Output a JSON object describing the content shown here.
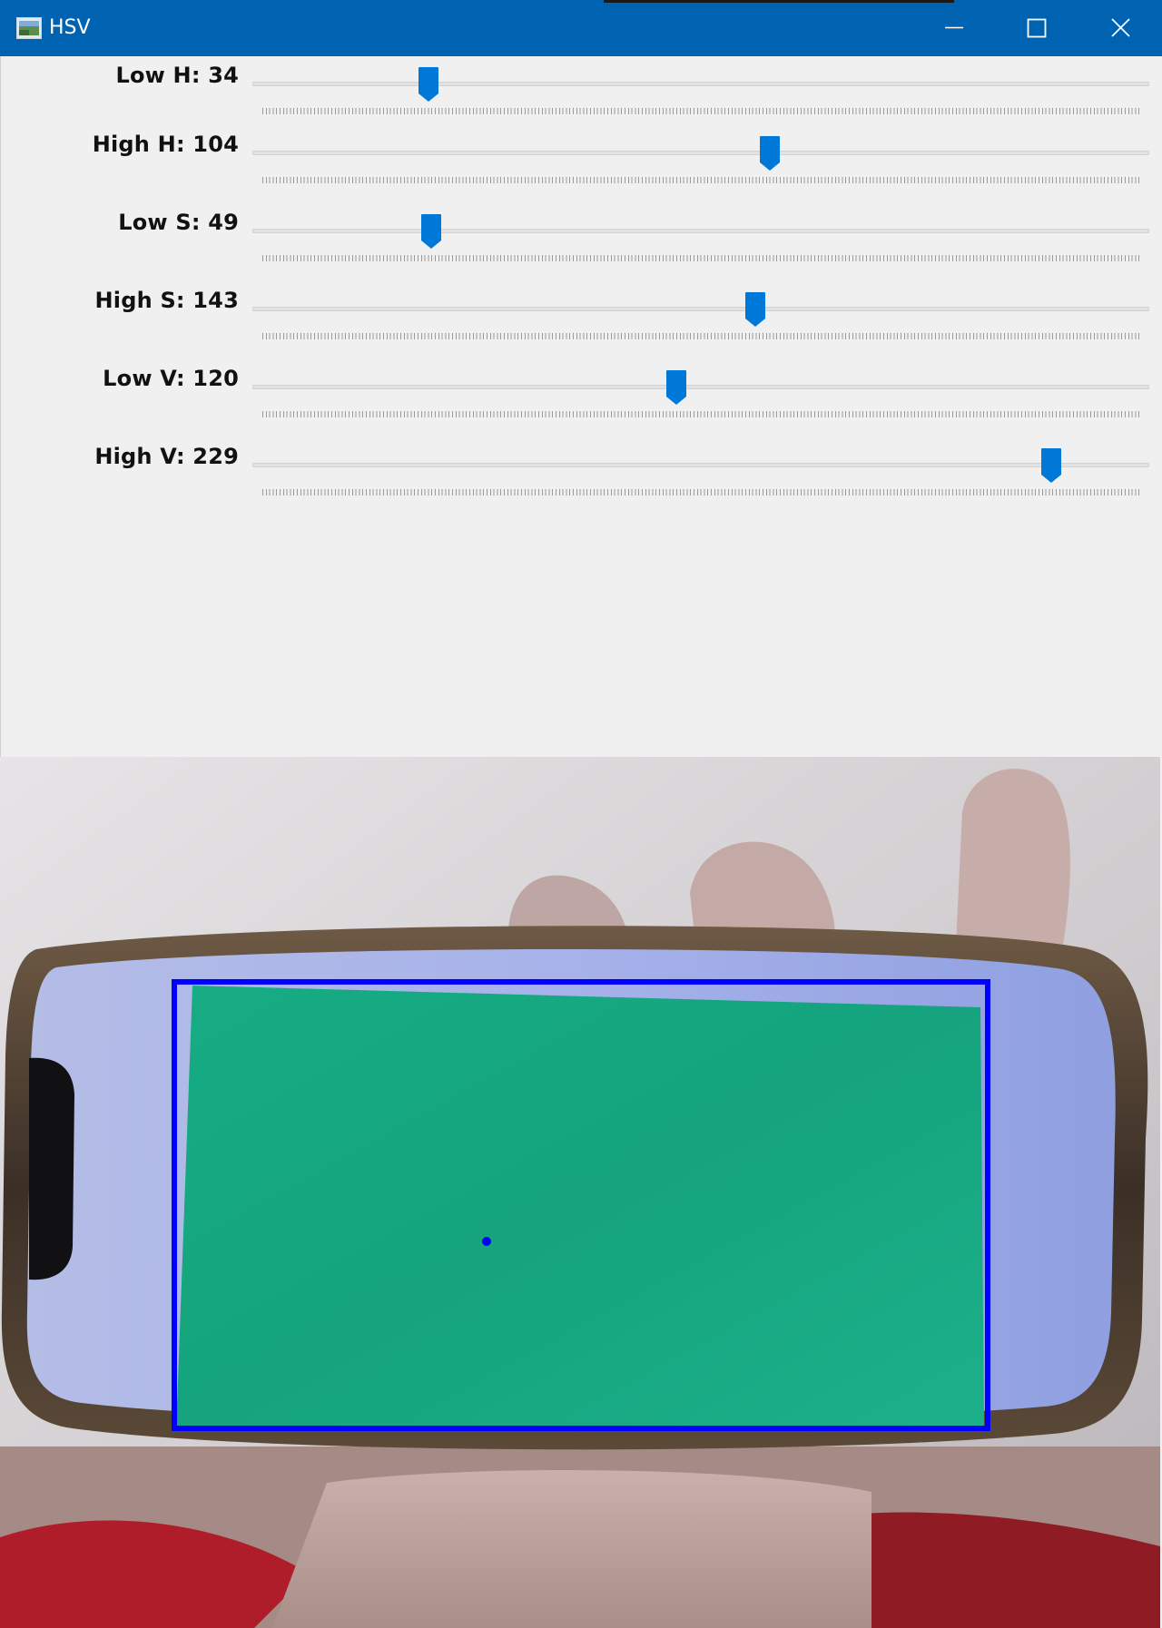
{
  "window": {
    "title": "HSV",
    "buttons": [
      "minimize",
      "maximize",
      "close"
    ]
  },
  "trackbars": [
    {
      "label": "Low H: 34",
      "value": 34,
      "max": 180
    },
    {
      "label": "High H: 104",
      "value": 104,
      "max": 180
    },
    {
      "label": "Low S: 49",
      "value": 49,
      "max": 255
    },
    {
      "label": "High S: 143",
      "value": 143,
      "max": 255
    },
    {
      "label": "Low V: 120",
      "value": 120,
      "max": 255
    },
    {
      "label": "High V: 229",
      "value": 229,
      "max": 255
    }
  ],
  "colors": {
    "titlebar": "#0063b1",
    "panel": "#f0f0f0",
    "thumb": "#0078d7",
    "detection_box": "#0000ff",
    "screen_green": "#18ad84"
  },
  "icons": {
    "app": "app-window-icon",
    "minimize": "minimize-icon",
    "maximize": "maximize-icon",
    "close": "close-icon"
  }
}
